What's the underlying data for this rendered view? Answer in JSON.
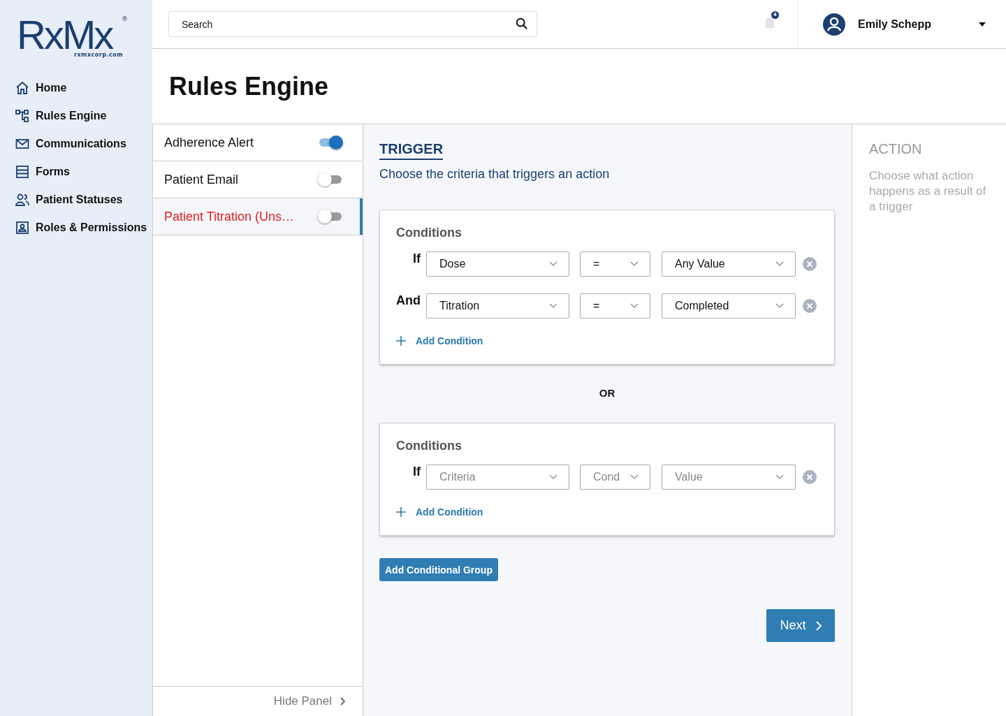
{
  "logo": {
    "text": "RxMx",
    "mark": "®",
    "site": "rxmxcorp.com"
  },
  "nav": [
    {
      "label": "Home",
      "kind": "home"
    },
    {
      "label": "Rules Engine",
      "kind": "rules"
    },
    {
      "label": "Communications",
      "kind": "mail"
    },
    {
      "label": "Forms",
      "kind": "forms"
    },
    {
      "label": "Patient Statuses",
      "kind": "people"
    },
    {
      "label": "Roles & Permissions",
      "kind": "badge"
    }
  ],
  "search": {
    "placeholder": "Search"
  },
  "notifications": {
    "count": "4"
  },
  "user": {
    "name": "Emily Schepp"
  },
  "page_title": "Rules Engine",
  "rules": [
    {
      "label": "Adherence Alert",
      "on": true,
      "selected": false,
      "unsaved": false
    },
    {
      "label": "Patient Email",
      "on": false,
      "selected": false,
      "unsaved": false
    },
    {
      "label": "Patient Titration (Uns…",
      "on": false,
      "selected": true,
      "unsaved": true
    }
  ],
  "hide_panel": "Hide Panel",
  "trigger": {
    "title": "TRIGGER",
    "subtitle": "Choose the criteria that triggers an action"
  },
  "groups": [
    {
      "title": "Conditions",
      "conditions": [
        {
          "joiner": "If",
          "criteria": {
            "value": "Dose"
          },
          "operator": {
            "value": "="
          },
          "value": {
            "value": "Any Value"
          }
        },
        {
          "joiner": "And",
          "criteria": {
            "value": "Titration"
          },
          "operator": {
            "value": "="
          },
          "value": {
            "value": "Completed"
          }
        }
      ],
      "add": "Add Condition"
    },
    {
      "title": "Conditions",
      "conditions": [
        {
          "joiner": "If",
          "criteria": {
            "placeholder": "Criteria"
          },
          "operator": {
            "placeholder": "Cond"
          },
          "value": {
            "placeholder": "Value"
          }
        }
      ],
      "add": "Add Condition"
    }
  ],
  "group_separator": "OR",
  "add_group": "Add Conditional Group",
  "next": "Next",
  "action": {
    "title": "ACTION",
    "text": "Choose what action happens as a result of a trigger"
  }
}
